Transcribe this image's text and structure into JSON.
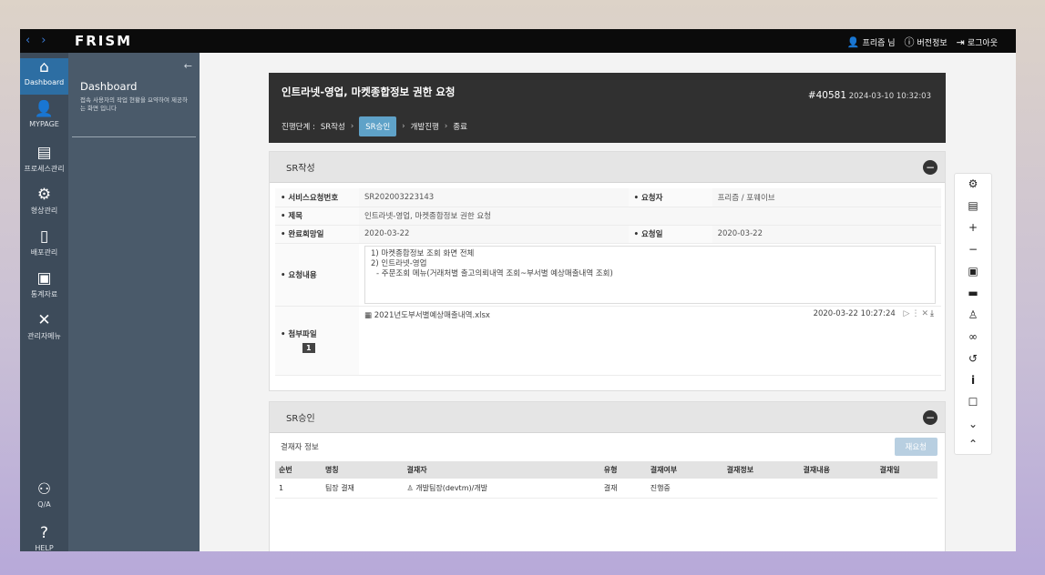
{
  "topbar": {
    "logo": "FRISM",
    "user": "프리즘 님",
    "version": "버전정보",
    "logout": "로그아웃"
  },
  "rail": [
    {
      "label": "Dashboard",
      "icon": "home-icon"
    },
    {
      "label": "MYPAGE",
      "icon": "user-icon"
    },
    {
      "label": "프로세스관리",
      "icon": "box-icon"
    },
    {
      "label": "형상관리",
      "icon": "gears-icon"
    },
    {
      "label": "배포관리",
      "icon": "phone-icon"
    },
    {
      "label": "통계자료",
      "icon": "chart-icon"
    },
    {
      "label": "관리자메뉴",
      "icon": "tools-icon"
    },
    {
      "label": "Q/A",
      "icon": "qa-icon"
    },
    {
      "label": "HELP",
      "icon": "help-icon"
    }
  ],
  "dashboard": {
    "title": "Dashboard",
    "desc": "접속 사용자의 작업 현황을 요약하여 제공하는 화면 입니다"
  },
  "request": {
    "title": "인트라넷-영업, 마켓종합정보 권한 요청",
    "id": "#40581",
    "datetime": "2024-03-10 10:32:03",
    "steps_label": "진행단계 :",
    "steps": [
      "SR작성",
      "SR승인",
      "개발진행",
      "종료"
    ],
    "current_step": "SR승인"
  },
  "sr_write": {
    "title": "SR작성",
    "labels": {
      "sr_no": "• 서비스요청번호",
      "requester": "• 요청자",
      "subject": "• 제목",
      "due_date": "• 완료희망일",
      "request_date": "• 요청일",
      "content": "• 요청내용",
      "attachment": "• 첨부파일"
    },
    "values": {
      "sr_no": "SR202003223143",
      "requester": "프리즘 / 포웨이브",
      "subject": "인트라넷-영업, 마켓종합정보 권한 요청",
      "due_date": "2020-03-22",
      "request_date": "2020-03-22",
      "content_lines": [
        "1) 마켓종합정보 조회 화면 전체",
        "2) 인트라넷-영업",
        "   - 주문조회 메뉴(거래처별 출고의뢰내역 조회~부서별 예상매출내역 조회)"
      ],
      "attachment_name": "2021년도부서별예상매출내역.xlsx",
      "attachment_date": "2020-03-22 10:27:24",
      "attachment_count": "1"
    }
  },
  "sr_approval": {
    "title": "SR승인",
    "sub_title": "결재자 정보",
    "resubmit": "재요청",
    "columns": [
      "순번",
      "명칭",
      "결재자",
      "유형",
      "결재여부",
      "결재정보",
      "결재내용",
      "결재일"
    ],
    "rows": [
      [
        "1",
        "팀장 결재",
        "개발팀장(devtm)/개발",
        "결재",
        "진행중",
        "",
        "",
        ""
      ]
    ]
  },
  "toolbar": [
    "settings-icon",
    "document-icon",
    "plus-icon",
    "minus-icon",
    "camera-icon",
    "print-icon",
    "user-search-icon",
    "link-icon",
    "history-icon",
    "info-icon",
    "comment-icon",
    "double-chevron-down-icon",
    "double-chevron-up-icon"
  ]
}
